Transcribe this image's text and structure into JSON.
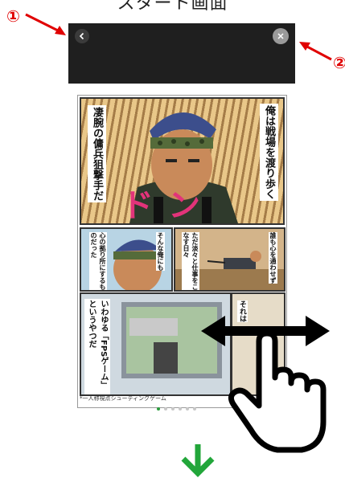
{
  "page_title": "スタート画面",
  "markers": {
    "one": "①",
    "two": "②"
  },
  "top_bar": {
    "back_icon": "chevron-left-icon",
    "close_icon": "close-icon"
  },
  "comic": {
    "panel1_left_text": "凄腕の傭兵狙撃手だ",
    "panel1_right_text": "俺は戦場を渡り歩く",
    "panel1_sfx": "ドン",
    "panel2_text1": "心の拠り所にするものだった",
    "panel2_text2": "そんな俺にも",
    "panel3_text1": "ただ淡々と仕事をこなす日々",
    "panel3_text2": "誰も心を通わせず",
    "panel4_text": "いわゆる「FPSゲーム」というやつだ",
    "panel5_text": "それは",
    "caption": "*一人称視点シューティングゲーム"
  },
  "pagination": {
    "total": 6,
    "active_index": 0
  },
  "colors": {
    "marker": "#e00000",
    "dot_active": "#2a9d3e",
    "arrow": "#22a63a"
  }
}
